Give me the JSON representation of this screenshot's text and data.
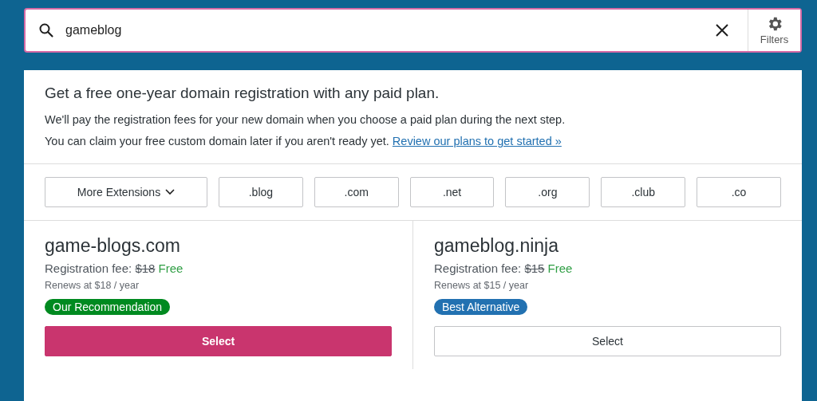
{
  "search": {
    "value": "gameblog",
    "filters_label": "Filters"
  },
  "notice": {
    "title": "Get a free one-year domain registration with any paid plan.",
    "lines": [
      {
        "text": "We'll pay the registration fees for your new domain when you choose a paid plan during the next step."
      },
      {
        "text": "You can claim your free custom domain later if you aren't ready yet.",
        "link": "Review our plans to get started »"
      }
    ]
  },
  "extensions": {
    "more": "More Extensions",
    "tlds": [
      ".blog",
      ".com",
      ".net",
      ".org",
      ".club",
      ".co"
    ]
  },
  "results": [
    {
      "domain": "game-blogs.com",
      "fee_label": "Registration fee:",
      "old_price": "$18",
      "price": "Free",
      "renewal": "Renews at $18 / year",
      "badge": {
        "kind": "recommendation",
        "text": "Our Recommendation"
      },
      "primary": true,
      "button": "Select"
    },
    {
      "domain": "gameblog.ninja",
      "fee_label": "Registration fee:",
      "old_price": "$15",
      "price": "Free",
      "renewal": "Renews at $15 / year",
      "badge": {
        "kind": "alternative",
        "text": "Best Alternative"
      },
      "primary": false,
      "button": "Select"
    }
  ]
}
